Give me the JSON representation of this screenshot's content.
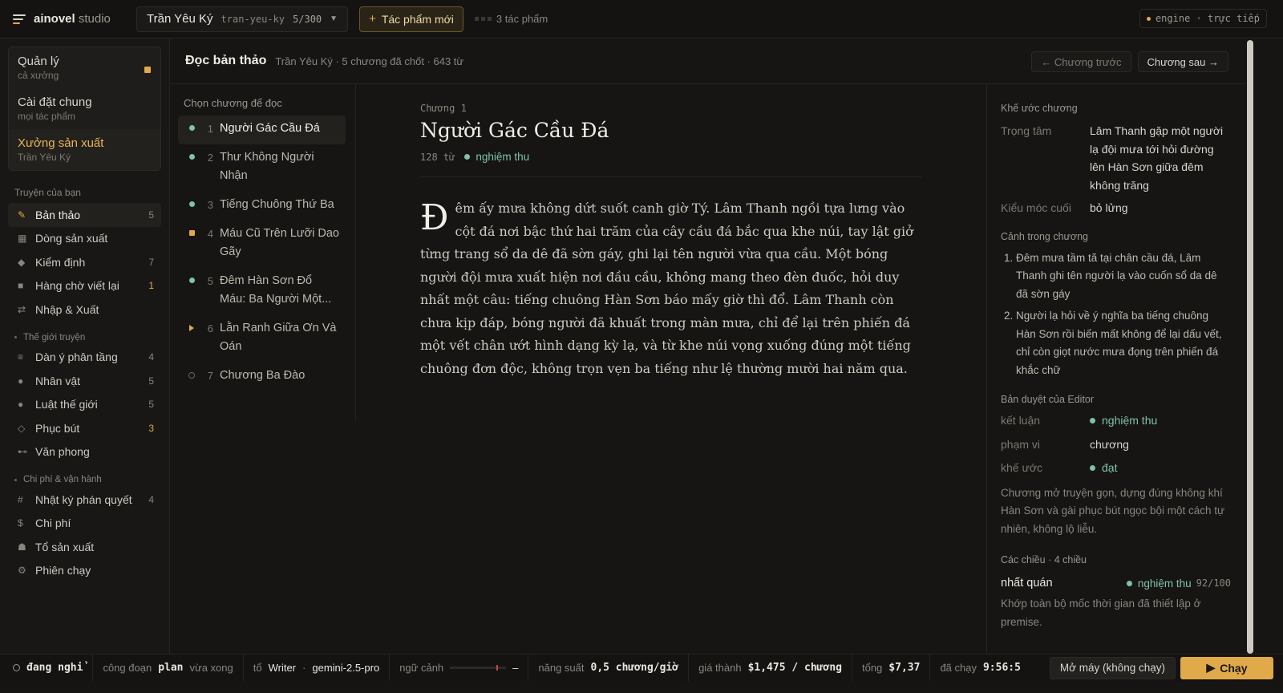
{
  "colors": {
    "accent": "#e0a94a",
    "ok": "#7fc3a4",
    "bg": "#161514"
  },
  "topbar": {
    "brand": "ainovel",
    "brand_suffix": "studio",
    "project_name": "Trần Yêu Ký",
    "project_slug": "tran-yeu-ky",
    "project_progress": "5/300",
    "new_work_label": "Tác phẩm mới",
    "works_count": "3 tác phẩm",
    "engine_status": "engine · trực tiếp"
  },
  "scopes": [
    {
      "title": "Quản lý",
      "sub": "cả xưởng"
    },
    {
      "title": "Cài đặt chung",
      "sub": "mọi tác phẩm"
    },
    {
      "title": "Xưởng sản xuất",
      "sub": "Trần Yêu Ký"
    }
  ],
  "sidebar": {
    "section_stories": "Truyện của bạn",
    "section_world": "Thế giới truyện",
    "section_ops": "Chi phí & vận hành",
    "stories": [
      {
        "icon": "pencil-icon",
        "glyph": "✎",
        "label": "Bản thảo",
        "count": "5"
      },
      {
        "icon": "pipeline-icon",
        "glyph": "▦",
        "label": "Dòng sản xuất",
        "count": ""
      },
      {
        "icon": "diamond-icon",
        "glyph": "◆",
        "label": "Kiểm định",
        "count": "7"
      },
      {
        "icon": "queue-icon",
        "glyph": "■",
        "label": "Hàng chờ viết lại",
        "count": "1"
      },
      {
        "icon": "swap-icon",
        "glyph": "⇄",
        "label": "Nhập & Xuất",
        "count": ""
      }
    ],
    "world": [
      {
        "icon": "outline-icon",
        "glyph": "≡",
        "label": "Dàn ý phân tầng",
        "count": "4"
      },
      {
        "icon": "character-icon",
        "glyph": "●",
        "label": "Nhân vật",
        "count": "5"
      },
      {
        "icon": "rule-icon",
        "glyph": "●",
        "label": "Luật thế giới",
        "count": "5"
      },
      {
        "icon": "foreshadow-icon",
        "glyph": "◇",
        "label": "Phục bút",
        "count": "3"
      },
      {
        "icon": "style-icon",
        "glyph": "⊷",
        "label": "Văn phong",
        "count": ""
      }
    ],
    "ops": [
      {
        "icon": "hash-icon",
        "glyph": "#",
        "label": "Nhật ký phán quyết",
        "count": "4"
      },
      {
        "icon": "dollar-icon",
        "glyph": "$",
        "label": "Chi phí",
        "count": ""
      },
      {
        "icon": "bell-icon",
        "glyph": "☗",
        "label": "Tổ sản xuất",
        "count": ""
      },
      {
        "icon": "run-icon",
        "glyph": "⚙",
        "label": "Phiên chạy",
        "count": ""
      }
    ]
  },
  "header": {
    "title": "Đọc bản thảo",
    "meta": "Trần Yêu Ký · 5 chương đã chốt · 643 từ",
    "prev_label": "← Chương trước",
    "next_label": "Chương sau →"
  },
  "chapters": {
    "heading": "Chọn chương để đọc",
    "items": [
      {
        "num": "1",
        "title": "Người Gác Cầu Đá",
        "status": "done"
      },
      {
        "num": "2",
        "title": "Thư Không Người Nhận",
        "status": "done"
      },
      {
        "num": "3",
        "title": "Tiếng Chuông Thứ Ba",
        "status": "done"
      },
      {
        "num": "4",
        "title": "Máu Cũ Trên Lưỡi Dao Gãy",
        "status": "rewrite"
      },
      {
        "num": "5",
        "title": "Đêm Hàn Sơn Đổ Máu: Ba Người Một...",
        "status": "done"
      },
      {
        "num": "6",
        "title": "Lằn Ranh Giữa Ơn Và Oán",
        "status": "running"
      },
      {
        "num": "7",
        "title": "Chương Ba Đào",
        "status": "todo"
      }
    ]
  },
  "reader": {
    "kicker": "Chương 1",
    "title": "Người Gác Cầu Đá",
    "words": "128 từ",
    "verdict": "nghiệm thu",
    "dropcap": "Đ",
    "body": "êm ấy mưa không dứt suốt canh giờ Tý. Lâm Thanh ngồi tựa lưng vào cột đá nơi bậc thứ hai trăm của cây cầu đá bắc qua khe núi, tay lật giở từng trang sổ da dê đã sờn gáy, ghi lại tên người vừa qua cầu. Một bóng người đội mưa xuất hiện nơi đầu cầu, không mang theo đèn đuốc, hỏi duy nhất một câu: tiếng chuông Hàn Sơn báo mấy giờ thì đổ. Lâm Thanh còn chưa kịp đáp, bóng người đã khuất trong màn mưa, chỉ để lại trên phiến đá một vết chân ướt hình dạng kỳ lạ, và từ khe núi vọng xuống đúng một tiếng chuông đơn độc, không trọn vẹn ba tiếng như lệ thường mười hai năm qua."
  },
  "panel": {
    "contract_heading": "Khế ước chương",
    "focus_key": "Trọng tâm",
    "focus_val": "Lâm Thanh gặp một người lạ đội mưa tới hỏi đường lên Hàn Sơn giữa đêm không trăng",
    "hook_key": "Kiểu móc cuối",
    "hook_val": "bỏ lửng",
    "scenes_heading": "Cảnh trong chương",
    "scenes": [
      "Đêm mưa tầm tã tại chân cầu đá, Lâm Thanh ghi tên người lạ vào cuốn sổ da dê đã sờn gáy",
      "Người lạ hỏi về ý nghĩa ba tiếng chuông Hàn Sơn rồi biến mất không để lại dấu vết, chỉ còn giọt nước mưa đọng trên phiến đá khắc chữ"
    ],
    "review_heading": "Bản duyệt của Editor",
    "verdict_key": "kết luận",
    "verdict_val": "nghiệm thu",
    "scope_key": "phạm vi",
    "scope_val": "chương",
    "contract_key": "khế ước",
    "contract_val": "đạt",
    "review_note": "Chương mở truyện gọn, dựng đúng không khí Hàn Sơn và gài phục bút ngọc bội một cách tự nhiên, không lộ liễu.",
    "moves_heading": "Các chiều · 4 chiều",
    "move_name": "nhất quán",
    "move_verdict": "nghiệm thu",
    "move_score": "92/100",
    "move_note": "Khớp toàn bộ mốc thời gian đã thiết lập ở premise."
  },
  "statusbar": {
    "state": "đang nghỉ",
    "stage_label": "công đoạn",
    "stage_val": "plan",
    "stage_note": "vừa xong",
    "team_label": "tổ",
    "team_val": "Writer",
    "model": "gemini-2.5-pro",
    "context_label": "ngữ cảnh",
    "context_val": "–",
    "throughput_label": "năng suất",
    "throughput_val": "0,5 chương/giờ",
    "cost_label": "giá thành",
    "cost_val": "$1,475 / chương",
    "total_label": "tổng",
    "total_val": "$7,37",
    "runtime_label": "đã chạy",
    "runtime_val": "9:56:5",
    "machine_label": "Mở máy (không chạy)",
    "run_label": "Chạy"
  }
}
